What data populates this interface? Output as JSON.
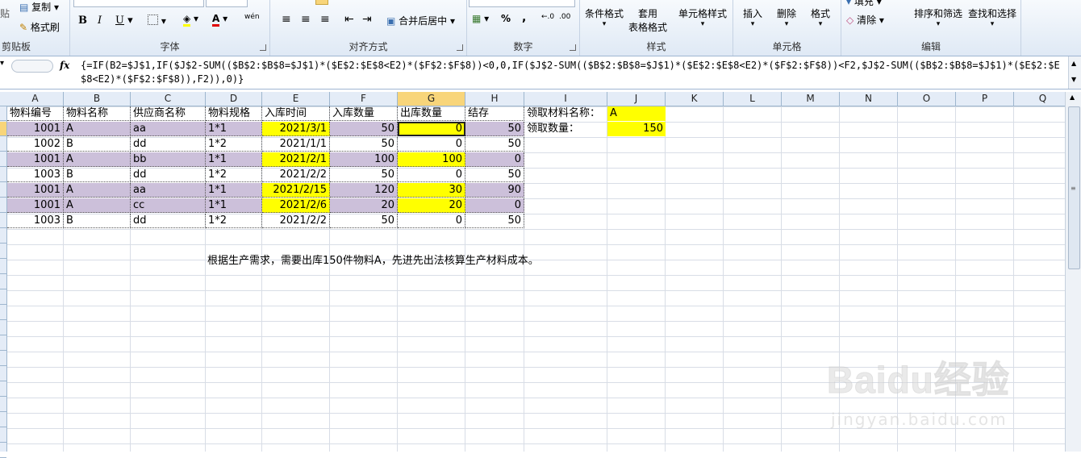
{
  "ribbon": {
    "clipboard": {
      "label": "剪贴板",
      "paste": "贴",
      "copy": "复制",
      "format_painter": "格式刷"
    },
    "font": {
      "label": "字体",
      "bold": "B",
      "italic": "I",
      "underline": "U",
      "font_color": "A",
      "phonetic": "wén"
    },
    "alignment": {
      "label": "对齐方式",
      "merge_center": "合并后居中"
    },
    "number": {
      "label": "数字",
      "percent": "%",
      "comma": ","
    },
    "styles": {
      "label": "样式",
      "conditional": "条件格式",
      "table_format_line1": "套用",
      "table_format_line2": "表格格式",
      "cell_styles": "单元格样式"
    },
    "cells": {
      "label": "单元格",
      "insert": "插入",
      "delete": "删除",
      "format": "格式"
    },
    "editing": {
      "label": "编辑",
      "fill": "填充",
      "clear": "清除",
      "sort_filter": "排序和筛选",
      "find_select": "查找和选择"
    }
  },
  "formula_bar": {
    "fx": "fx",
    "formula": "{=IF(B2=$J$1,IF($J$2-SUM(($B$2:$B$8=$J$1)*($E$2:$E$8<E2)*($F$2:$F$8))<0,0,IF($J$2-SUM(($B$2:$B$8=$J$1)*($E$2:$E$8<E2)*($F$2:$F$8))<F2,$J$2-SUM(($B$2:$B$8=$J$1)*($E$2:$E$8<E2)*($F$2:$F$8)),F2)),0)}"
  },
  "columns": [
    "A",
    "B",
    "C",
    "D",
    "E",
    "F",
    "G",
    "H",
    "I",
    "J",
    "K",
    "L",
    "M",
    "N",
    "O",
    "P",
    "Q"
  ],
  "selected_column": "G",
  "headers": [
    "物料编号",
    "物料名称",
    "供应商名称",
    "物料规格",
    "入库时间",
    "入库数量",
    "出库数量",
    "结存"
  ],
  "rows": [
    {
      "code": "1001",
      "name": "A",
      "supplier": "aa",
      "spec": "1*1",
      "date": "2021/3/1",
      "in": "50",
      "out": "0",
      "stock": "50"
    },
    {
      "code": "1002",
      "name": "B",
      "supplier": "dd",
      "spec": "1*2",
      "date": "2021/1/1",
      "in": "50",
      "out": "0",
      "stock": "50"
    },
    {
      "code": "1001",
      "name": "A",
      "supplier": "bb",
      "spec": "1*1",
      "date": "2021/2/1",
      "in": "100",
      "out": "100",
      "stock": "0"
    },
    {
      "code": "1003",
      "name": "B",
      "supplier": "dd",
      "spec": "1*2",
      "date": "2021/2/2",
      "in": "50",
      "out": "0",
      "stock": "50"
    },
    {
      "code": "1001",
      "name": "A",
      "supplier": "aa",
      "spec": "1*1",
      "date": "2021/2/15",
      "in": "120",
      "out": "30",
      "stock": "90"
    },
    {
      "code": "1001",
      "name": "A",
      "supplier": "cc",
      "spec": "1*1",
      "date": "2021/2/6",
      "in": "20",
      "out": "20",
      "stock": "0"
    },
    {
      "code": "1003",
      "name": "B",
      "supplier": "dd",
      "spec": "1*2",
      "date": "2021/2/2",
      "in": "50",
      "out": "0",
      "stock": "50"
    }
  ],
  "lookup": {
    "label1": "领取材料名称：",
    "value1": "A",
    "label2": "领取数量：",
    "value2": "150"
  },
  "note": "根据生产需求，需要出库150件物料A，先进先出法核算生产材料成本。",
  "watermark": {
    "main": "Baidu经验",
    "sub": "jingyan.baidu.com"
  },
  "colors": {
    "purple_fill": "#ccc0da",
    "yellow_fill": "#ffff00",
    "selected_header": "#f8d57a"
  }
}
